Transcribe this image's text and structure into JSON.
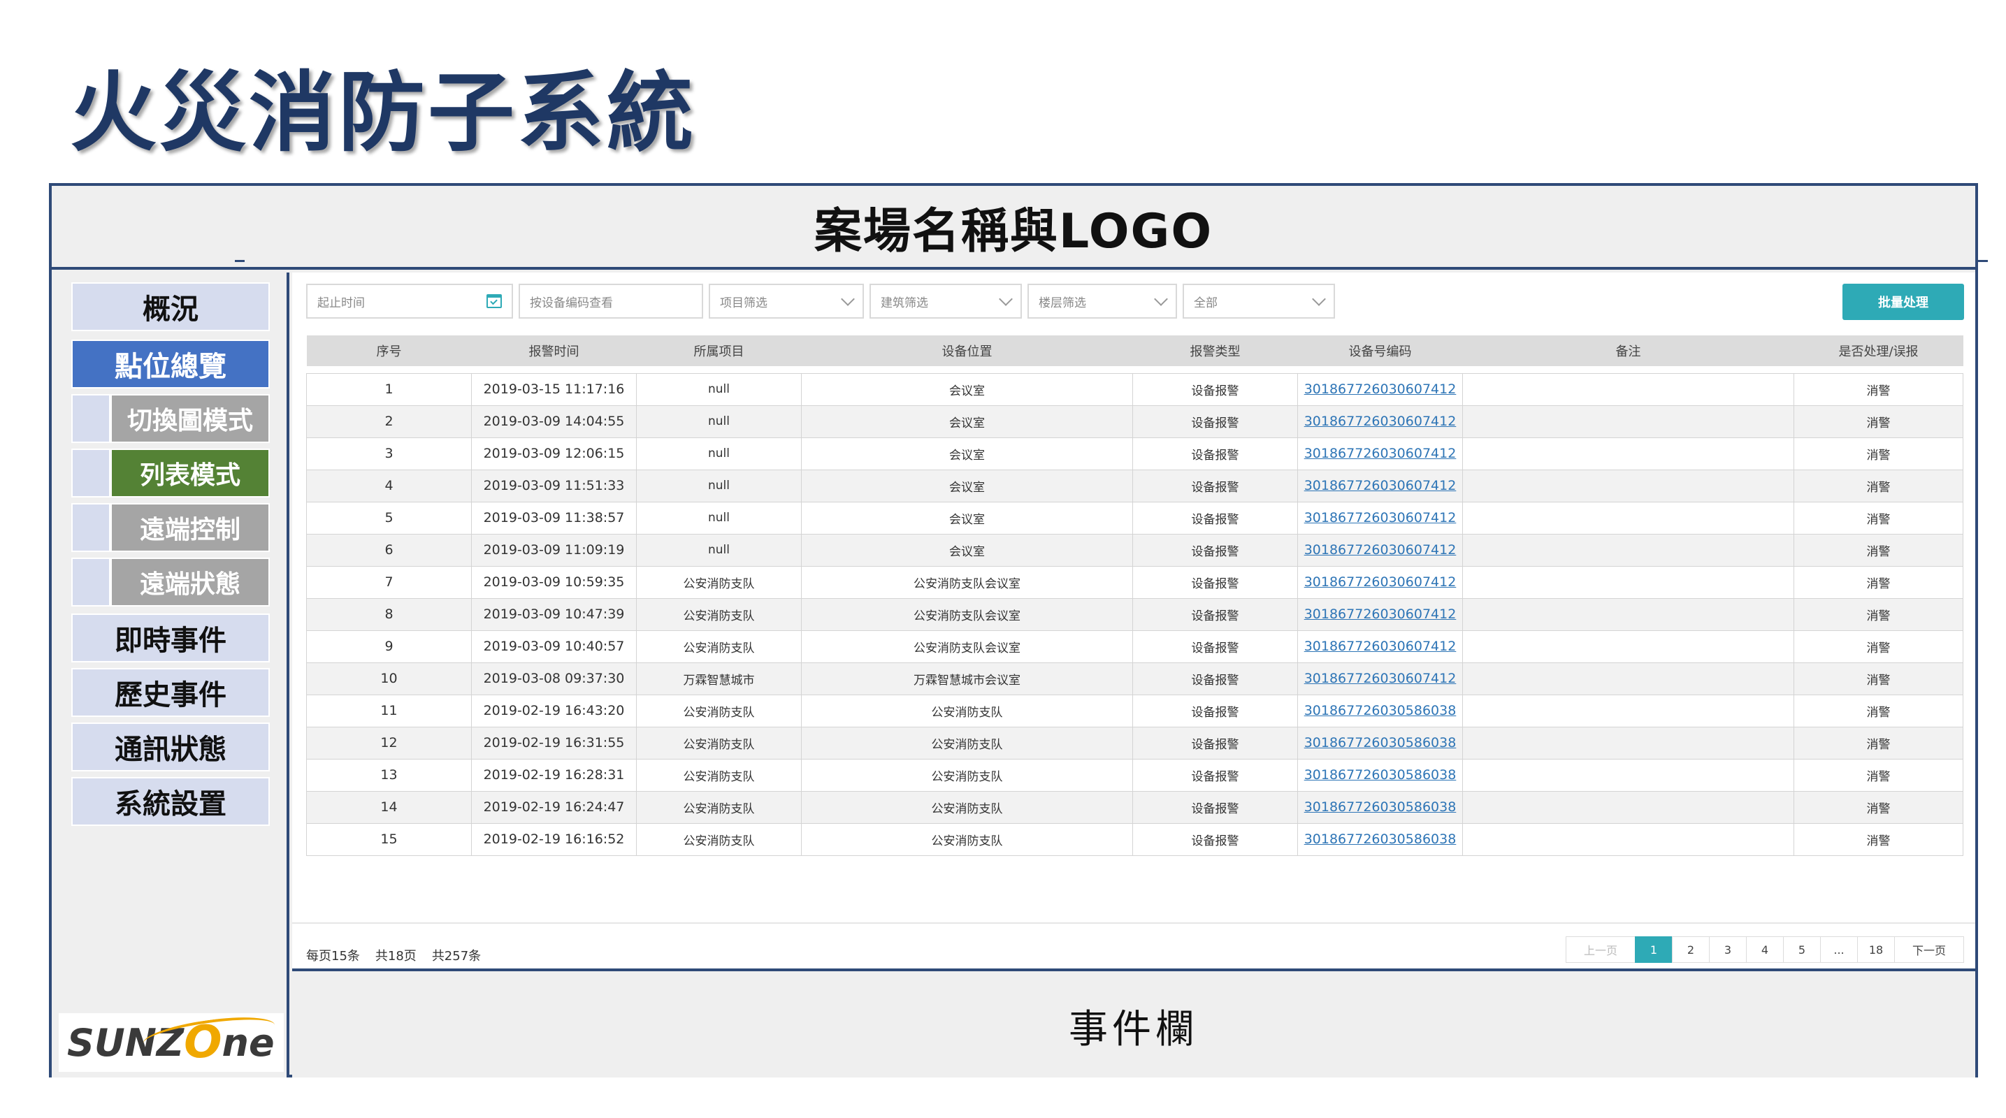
{
  "slide_title": "火災消防子系統",
  "header_title": "案場名稱與LOGO",
  "event_bar_label": "事件欄",
  "sidebar": {
    "items": [
      {
        "label": "概況"
      },
      {
        "label": "點位總覽",
        "active": true
      },
      {
        "label": "即時事件"
      },
      {
        "label": "歷史事件"
      },
      {
        "label": "通訊狀態"
      },
      {
        "label": "系統設置"
      }
    ],
    "sub_items": [
      {
        "label": "切換圖模式"
      },
      {
        "label": "列表模式",
        "active": true
      },
      {
        "label": "遠端控制"
      },
      {
        "label": "遠端狀態"
      }
    ]
  },
  "logo": {
    "text_pre": "SUNZ",
    "text_o": "O",
    "text_post": "ne"
  },
  "filters": {
    "time_placeholder": "起止时间",
    "device_code_placeholder": "按设备编码查看",
    "project_filter": "项目筛选",
    "building_filter": "建筑筛选",
    "floor_filter": "楼层筛选",
    "type_filter": "全部"
  },
  "batch_button": "批量处理",
  "table": {
    "headers": [
      "序号",
      "报警时间",
      "所属项目",
      "设备位置",
      "报警类型",
      "设备号编码",
      "备注",
      "是否处理/误报"
    ],
    "rows": [
      [
        "1",
        "2019-03-15 11:17:16",
        "null",
        "会议室",
        "设备报警",
        "301867726030607412",
        "",
        "消警"
      ],
      [
        "2",
        "2019-03-09 14:04:55",
        "null",
        "会议室",
        "设备报警",
        "301867726030607412",
        "",
        "消警"
      ],
      [
        "3",
        "2019-03-09 12:06:15",
        "null",
        "会议室",
        "设备报警",
        "301867726030607412",
        "",
        "消警"
      ],
      [
        "4",
        "2019-03-09 11:51:33",
        "null",
        "会议室",
        "设备报警",
        "301867726030607412",
        "",
        "消警"
      ],
      [
        "5",
        "2019-03-09 11:38:57",
        "null",
        "会议室",
        "设备报警",
        "301867726030607412",
        "",
        "消警"
      ],
      [
        "6",
        "2019-03-09 11:09:19",
        "null",
        "会议室",
        "设备报警",
        "301867726030607412",
        "",
        "消警"
      ],
      [
        "7",
        "2019-03-09 10:59:35",
        "公安消防支队",
        "公安消防支队会议室",
        "设备报警",
        "301867726030607412",
        "",
        "消警"
      ],
      [
        "8",
        "2019-03-09 10:47:39",
        "公安消防支队",
        "公安消防支队会议室",
        "设备报警",
        "301867726030607412",
        "",
        "消警"
      ],
      [
        "9",
        "2019-03-09 10:40:57",
        "公安消防支队",
        "公安消防支队会议室",
        "设备报警",
        "301867726030607412",
        "",
        "消警"
      ],
      [
        "10",
        "2019-03-08 09:37:30",
        "万霖智慧城市",
        "万霖智慧城市会议室",
        "设备报警",
        "301867726030607412",
        "",
        "消警"
      ],
      [
        "11",
        "2019-02-19 16:43:20",
        "公安消防支队",
        "公安消防支队",
        "设备报警",
        "301867726030586038",
        "",
        "消警"
      ],
      [
        "12",
        "2019-02-19 16:31:55",
        "公安消防支队",
        "公安消防支队",
        "设备报警",
        "301867726030586038",
        "",
        "消警"
      ],
      [
        "13",
        "2019-02-19 16:28:31",
        "公安消防支队",
        "公安消防支队",
        "设备报警",
        "301867726030586038",
        "",
        "消警"
      ],
      [
        "14",
        "2019-02-19 16:24:47",
        "公安消防支队",
        "公安消防支队",
        "设备报警",
        "301867726030586038",
        "",
        "消警"
      ],
      [
        "15",
        "2019-02-19 16:16:52",
        "公安消防支队",
        "公安消防支队",
        "设备报警",
        "301867726030586038",
        "",
        "消警"
      ]
    ]
  },
  "pager": {
    "per_page": "每页15条",
    "total_pages": "共18页",
    "total_items": "共257条",
    "prev": "上一页",
    "pages": [
      "1",
      "2",
      "3",
      "4",
      "5",
      "...",
      "18"
    ],
    "current": "1",
    "next": "下一页"
  },
  "colors": {
    "title": "#1f3864",
    "frame_border": "#2f4a78",
    "nav_active": "#4472c4",
    "sub_active": "#548235",
    "accent": "#2eaab6",
    "link": "#2e75b6"
  }
}
